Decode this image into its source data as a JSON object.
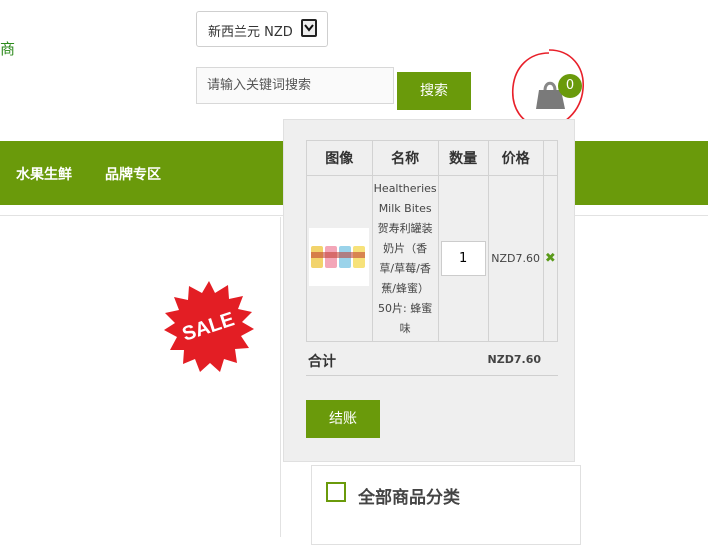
{
  "header": {
    "logo_fragment": "商",
    "currency": {
      "selected": "新西兰元 NZD"
    },
    "search": {
      "placeholder": "请输入关键词搜索",
      "button_label": "搜索"
    },
    "cart": {
      "count": "0"
    }
  },
  "nav": {
    "items": [
      {
        "label": "水果生鲜"
      },
      {
        "label": "品牌专区"
      }
    ]
  },
  "sale_badge": {
    "text": "SALE"
  },
  "cart_dropdown": {
    "columns": [
      "图像",
      "名称",
      "数量",
      "价格"
    ],
    "items": [
      {
        "name_lines": [
          "Healtheries",
          "Milk Bites",
          "贺寿利罐装",
          "奶片（香",
          "草/草莓/香",
          "蕉/蜂蜜）",
          "50片: 蜂蜜",
          "味"
        ],
        "quantity": "1",
        "price": "NZD7.60"
      }
    ],
    "total_label": "合计",
    "total_value": "NZD7.60",
    "checkout_label": "结账"
  },
  "sidebar": {
    "category_title": "全部商品分类"
  },
  "colors": {
    "brand_green": "#6a9a0b",
    "annotation_red": "#e8202a",
    "sale_red": "#e31e24"
  }
}
